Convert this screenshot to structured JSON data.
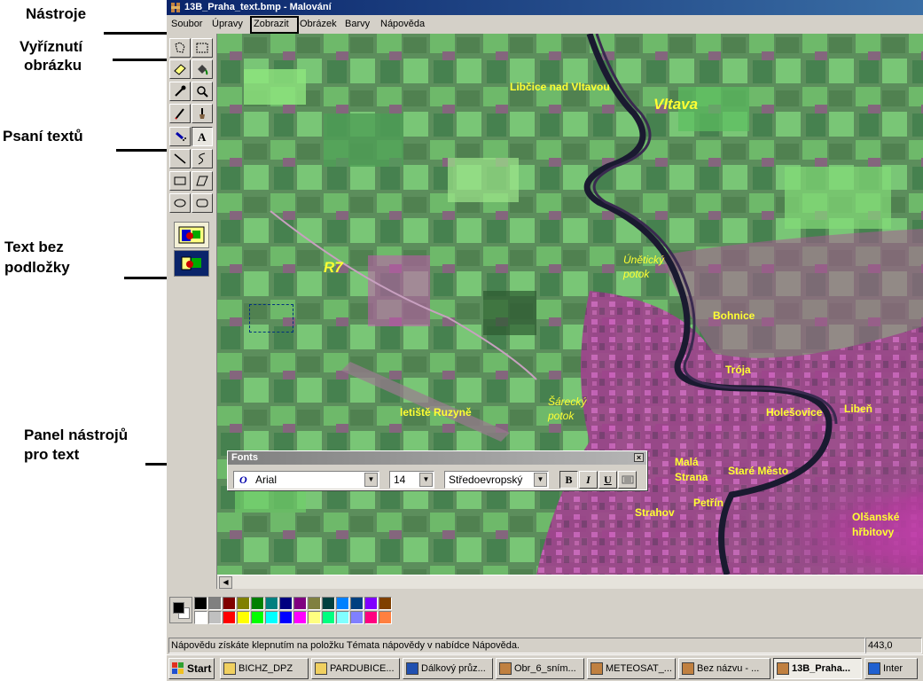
{
  "annotations": {
    "tools": "Nástroje",
    "cutout_line1": "Vyříznutí",
    "cutout_line2": "obrázku",
    "text_writing": "Psaní textů",
    "no_bg_line1": "Text  bez",
    "no_bg_line2": "podložky",
    "text_panel_line1": "Panel nástrojů",
    "text_panel_line2": "pro text"
  },
  "window": {
    "title": "13B_Praha_text.bmp - Malování"
  },
  "menu": {
    "file": "Soubor",
    "edit": "Úpravy",
    "view": "Zobrazit",
    "image": "Obrázek",
    "colors": "Barvy",
    "help": "Nápověda"
  },
  "map_labels": {
    "libcice": "Libčice nad Vltavou",
    "vltava": "Vltava",
    "unetice_1": "Únětický",
    "unetice_2": "potok",
    "r7": "R7",
    "bohnice": "Bohnice",
    "troja": "Trója",
    "holesovice": "Holešovice",
    "liben": "Libeň",
    "ruzyne": "letiště Ruzyně",
    "sarka_1": "Šárecký",
    "sarka_2": "potok",
    "mala_strana_1": "Malá",
    "mala_strana_2": "Strana",
    "stare_mesto": "Staré Město",
    "petrin": "Petřín",
    "strahov": "Strahov",
    "olsany_1": "Olšanské",
    "olsany_2": "hřbitovy"
  },
  "fonts_toolbar": {
    "title": "Fonts",
    "close": "×",
    "font_name": "Arial",
    "font_size": "14",
    "script": "Středoevropský",
    "bold": "B",
    "italic": "I",
    "underline": "U"
  },
  "palette": {
    "foreground": "#000000",
    "background": "#ffffff",
    "row1": [
      "#000000",
      "#808080",
      "#800000",
      "#808000",
      "#008000",
      "#008080",
      "#000080",
      "#800080",
      "#808040",
      "#004040",
      "#0080ff",
      "#004080",
      "#8000ff",
      "#804000"
    ],
    "row2": [
      "#ffffff",
      "#c0c0c0",
      "#ff0000",
      "#ffff00",
      "#00ff00",
      "#00ffff",
      "#0000ff",
      "#ff00ff",
      "#ffff80",
      "#00ff80",
      "#80ffff",
      "#8080ff",
      "#ff0080",
      "#ff8040"
    ]
  },
  "status": {
    "help_text": "Nápovědu získáte klepnutím na položku Témata nápovědy v nabídce Nápověda.",
    "coords": "443,0"
  },
  "taskbar": {
    "start": "Start",
    "items": [
      "BICHZ_DPZ",
      "PARDUBICE...",
      "Dálkový průz...",
      "Obr_6_sním...",
      "METEOSAT_...",
      "Bez názvu - ...",
      "13B_Praha...",
      "Inter"
    ]
  }
}
